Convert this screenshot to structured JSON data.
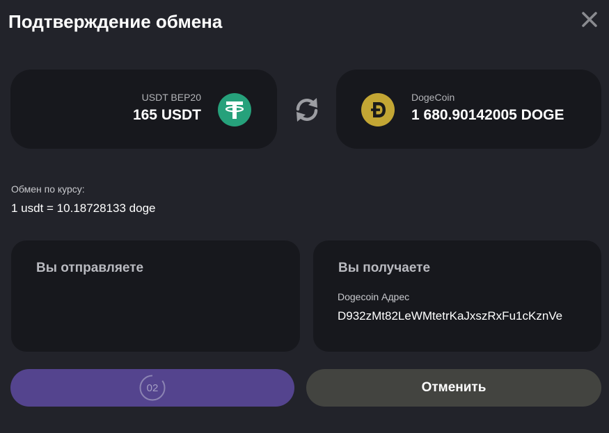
{
  "dialog": {
    "title": "Подтверждение обмена",
    "close_icon": "close-icon"
  },
  "exchange": {
    "from": {
      "network": "USDT BEP20",
      "amount": "165 USDT",
      "icon": "tether-icon",
      "icon_color": "#26a17b"
    },
    "swap_icon": "refresh-icon",
    "to": {
      "network": "DogeCoin",
      "amount": "1 680.90142005 DOGE",
      "icon": "dogecoin-icon",
      "icon_color": "#c3a634"
    }
  },
  "rate": {
    "label": "Обмен по курсу:",
    "value": "1 usdt = 10.18728133 doge"
  },
  "send_section": {
    "title": "Вы отправляете"
  },
  "receive_section": {
    "title": "Вы получаете",
    "address_label": "Dogecoin Адрес",
    "address": "D932zMt82LeWMtetrKaJxszRxFu1cKznVe"
  },
  "buttons": {
    "confirm_timer": "02",
    "confirm_color": "#54448e",
    "cancel_label": "Отменить",
    "cancel_color": "#434440"
  }
}
